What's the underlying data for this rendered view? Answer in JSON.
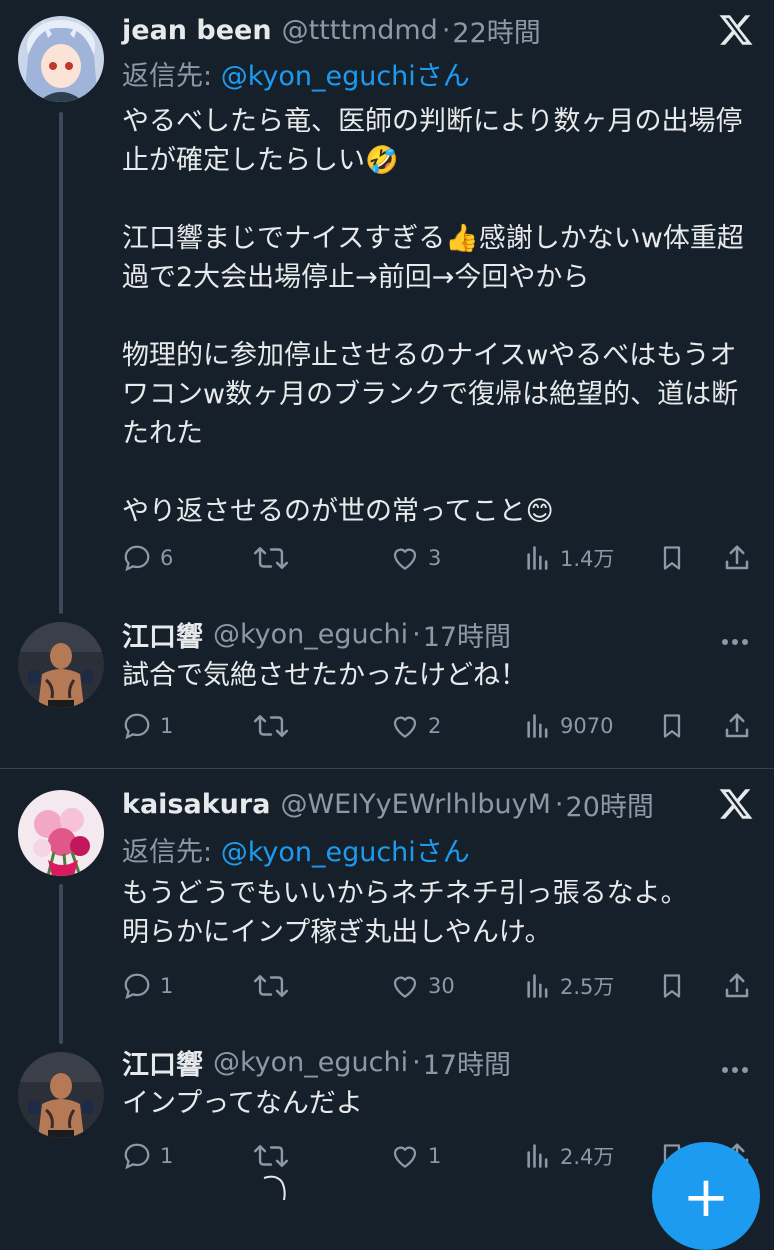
{
  "colors": {
    "background": "#15202b",
    "accent": "#1d9bf0",
    "muted": "#8b98a5",
    "text": "#e7e9ea"
  },
  "tweets": [
    {
      "name": "jean been",
      "handle": "@ttttmdmd",
      "time": "22時間",
      "reply_to_prefix": "返信先: ",
      "reply_to_mention": "@kyon_eguchi",
      "reply_to_suffix": "さん",
      "text": "やるべしたら竜、医師の判断により数ヶ月の出場停止が確定したらしい🤣\n\n江口響まじでナイスすぎる👍感謝しかないw体重超過で2大会出場停止→前回→今回やから\n\n物理的に参加停止させるのナイスwやるべはもうオワコンw数ヶ月のブランクで復帰は絶望的、道は断たれた\n\nやり返させるのが世の常ってこと😊",
      "replies": "6",
      "likes": "3",
      "views": "1.4万",
      "corner_icon": "x-logo-icon"
    },
    {
      "name": "江口響",
      "handle": "@kyon_eguchi",
      "time": "17時間",
      "text": "試合で気絶させたかったけどね！",
      "replies": "1",
      "likes": "2",
      "views": "9070",
      "corner_icon": "more-icon"
    },
    {
      "name": "kaisakura",
      "handle": "@WEIYyEWrlhlbuyM",
      "time": "20時間",
      "reply_to_prefix": "返信先: ",
      "reply_to_mention": "@kyon_eguchi",
      "reply_to_suffix": "さん",
      "text": "もうどうでもいいからネチネチ引っ張るなよ。\n明らかにインプ稼ぎ丸出しやんけ。",
      "replies": "1",
      "likes": "30",
      "views": "2.5万",
      "corner_icon": "x-logo-icon"
    },
    {
      "name": "江口響",
      "handle": "@kyon_eguchi",
      "time": "17時間",
      "text": "インプってなんだよ",
      "replies": "1",
      "likes": "1",
      "views": "2.4万",
      "corner_icon": "more-icon"
    }
  ],
  "time_separator": "·",
  "fab_symbol": "+"
}
